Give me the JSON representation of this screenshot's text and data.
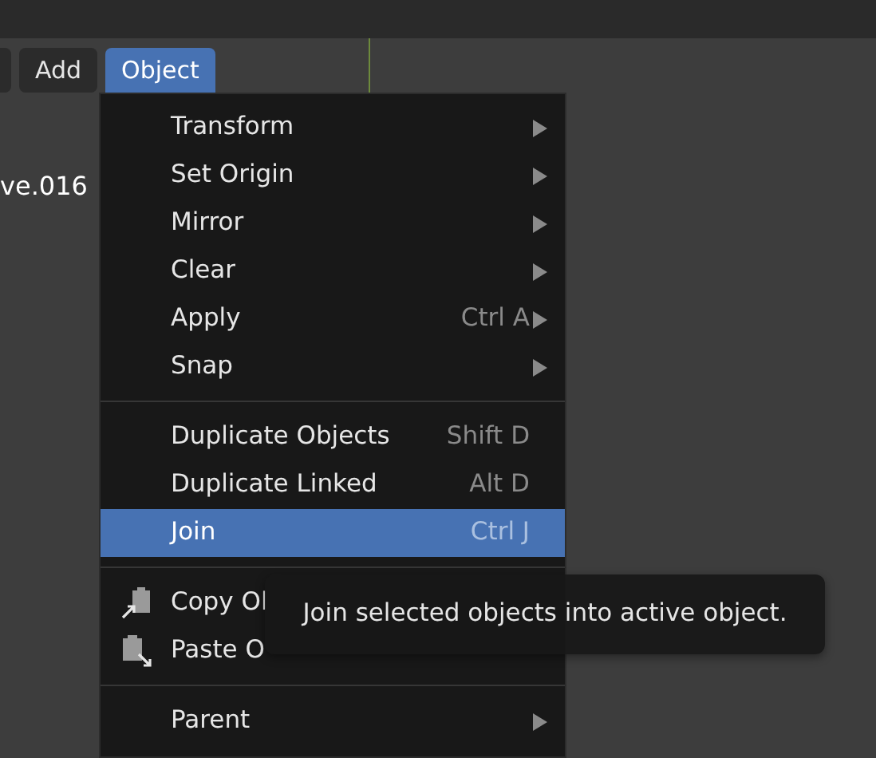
{
  "header": {
    "menus": [
      {
        "label": "Add",
        "selected": false
      },
      {
        "label": "Object",
        "selected": true
      }
    ]
  },
  "outliner_text": "ve.016",
  "menu": {
    "items": [
      {
        "kind": "item",
        "label": "Transform",
        "submenu": true,
        "selected": false
      },
      {
        "kind": "item",
        "label": "Set Origin",
        "submenu": true,
        "selected": false
      },
      {
        "kind": "item",
        "label": "Mirror",
        "submenu": true,
        "selected": false
      },
      {
        "kind": "item",
        "label": "Clear",
        "submenu": true,
        "selected": false
      },
      {
        "kind": "item",
        "label": "Apply",
        "shortcut": "Ctrl A",
        "submenu": true,
        "selected": false
      },
      {
        "kind": "item",
        "label": "Snap",
        "submenu": true,
        "selected": false
      },
      {
        "kind": "separator"
      },
      {
        "kind": "item",
        "label": "Duplicate Objects",
        "shortcut": "Shift D",
        "submenu": false,
        "selected": false
      },
      {
        "kind": "item",
        "label": "Duplicate Linked",
        "shortcut": "Alt D",
        "submenu": false,
        "selected": false
      },
      {
        "kind": "item",
        "label": "Join",
        "shortcut": "Ctrl J",
        "submenu": false,
        "selected": true
      },
      {
        "kind": "separator"
      },
      {
        "kind": "icon_item",
        "label": "Copy Ol",
        "submenu": false,
        "selected": false
      },
      {
        "kind": "icon_item",
        "label": "Paste O",
        "submenu": false,
        "selected": false
      },
      {
        "kind": "separator"
      },
      {
        "kind": "item",
        "label": "Parent",
        "submenu": true,
        "selected": false
      }
    ]
  },
  "tooltip": "Join selected objects into active object."
}
